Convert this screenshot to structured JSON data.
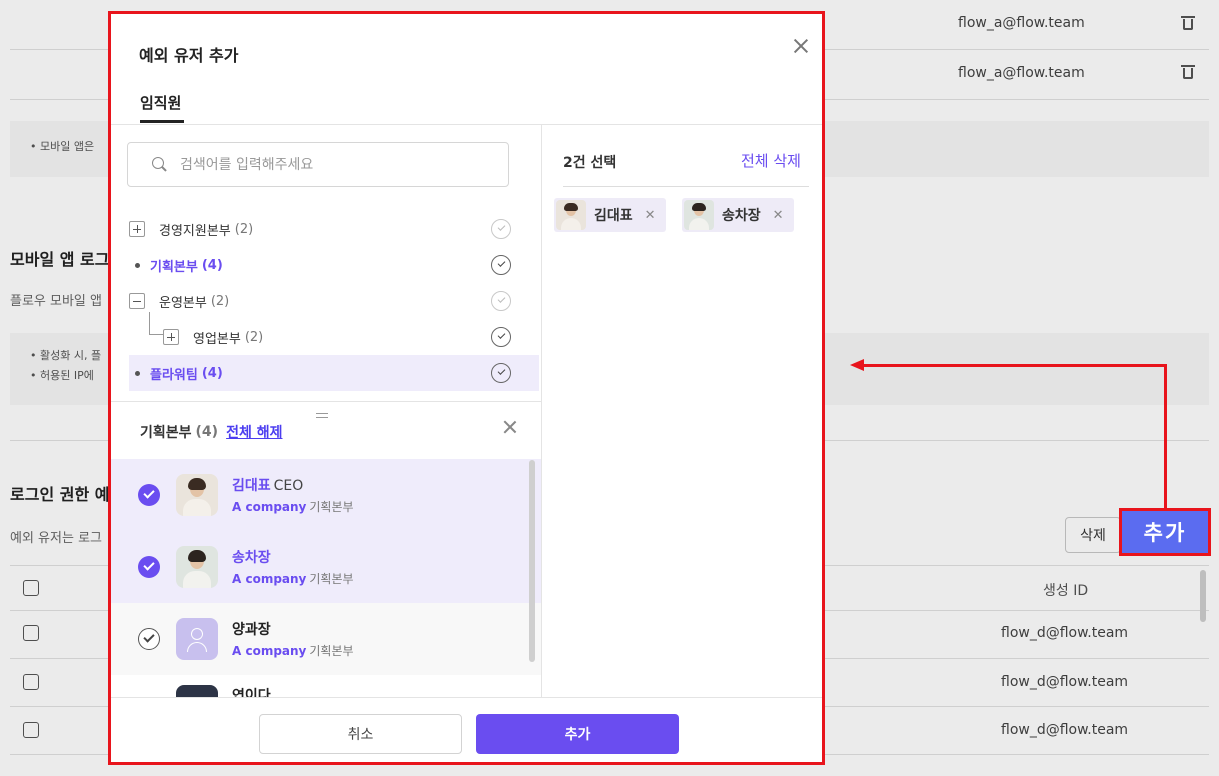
{
  "background": {
    "top_rows": [
      {
        "email": "flow_a@flow.team"
      },
      {
        "email": "flow_a@flow.team"
      }
    ],
    "notice_top": "• 모바일 앱은",
    "mobile_section_title": "모바일 앱 로그",
    "mobile_section_desc": "플로우 모바일 앱",
    "notice_mid_1": "• 활성화 시, 플",
    "notice_mid_2": "• 허용된 IP에",
    "login_section_title": "로그인 권한 예",
    "login_section_desc": "예외 유저는 로그",
    "delete_button": "삭제",
    "table_header_created_id": "생성 ID",
    "table_rows": [
      {
        "created_id": "flow_d@flow.team"
      },
      {
        "created_id": "flow_d@flow.team"
      },
      {
        "created_id": "flow_d@flow.team"
      }
    ]
  },
  "modal": {
    "title": "예외 유저 추가",
    "tab_label": "임직원",
    "search_placeholder": "검색어를 입력해주세요",
    "tree": [
      {
        "name": "경영지원본부",
        "count": "(2)",
        "kind": "plus"
      },
      {
        "name": "기획본부",
        "count": "(4)",
        "kind": "dot"
      },
      {
        "name": "운영본부",
        "count": "(2)",
        "kind": "minus"
      },
      {
        "name": "영업본부",
        "count": "(2)",
        "kind": "plus"
      },
      {
        "name": "플라워팀",
        "count": "(4)",
        "kind": "dot"
      }
    ],
    "dept_panel": {
      "name": "기획본부",
      "count": "(4)",
      "clear_all": "전체 해제"
    },
    "members": [
      {
        "name": "김대표",
        "role": "CEO",
        "company": "A company",
        "dept": "기획본부",
        "checked": true
      },
      {
        "name": "송차장",
        "role": "",
        "company": "A company",
        "dept": "기획본부",
        "checked": true
      },
      {
        "name": "양과장",
        "role": "",
        "company": "A company",
        "dept": "기획본부",
        "checked": false
      },
      {
        "name": "연이다",
        "role": "",
        "company": "",
        "dept": "",
        "checked": false
      }
    ],
    "selection": {
      "count_label": "2건 선택",
      "clear_all": "전체 삭제",
      "chips": [
        {
          "name": "김대표"
        },
        {
          "name": "송차장"
        }
      ]
    },
    "cancel_button": "취소",
    "add_button": "추가"
  },
  "annotation": {
    "callout_label": "추가",
    "color": "#e8141c"
  },
  "colors": {
    "accent": "#6a4df0",
    "highlight": "#efecfb"
  }
}
